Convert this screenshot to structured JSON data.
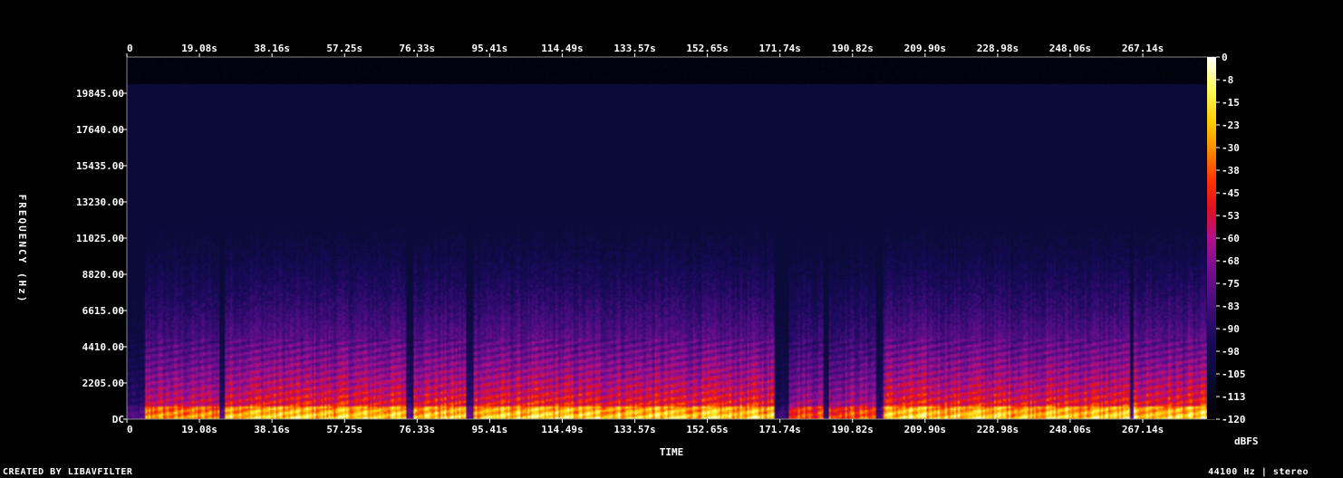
{
  "chart_data": {
    "type": "heatmap",
    "xlabel": "TIME",
    "ylabel": "FREQUENCY (Hz)",
    "x_ticks": [
      "0",
      "19.08s",
      "38.16s",
      "57.25s",
      "76.33s",
      "95.41s",
      "114.49s",
      "133.57s",
      "152.65s",
      "171.74s",
      "190.82s",
      "209.90s",
      "228.98s",
      "248.06s",
      "267.14s"
    ],
    "x_tick_values": [
      0,
      19.08,
      38.16,
      57.25,
      76.33,
      95.41,
      114.49,
      133.57,
      152.65,
      171.74,
      190.82,
      209.9,
      228.98,
      248.06,
      267.14
    ],
    "xlim": [
      0,
      286.2
    ],
    "y_ticks": [
      "DC",
      "2205.00",
      "4410.00",
      "6615.00",
      "8820.00",
      "11025.00",
      "13230.00",
      "15435.00",
      "17640.00",
      "19845.00"
    ],
    "y_tick_values": [
      0,
      2205,
      4410,
      6615,
      8820,
      11025,
      13230,
      15435,
      17640,
      19845
    ],
    "ylim": [
      0,
      22050
    ],
    "colorbar": {
      "label": "dBFS",
      "ticks": [
        "0",
        "-8",
        "-15",
        "-23",
        "-30",
        "-38",
        "-45",
        "-53",
        "-60",
        "-68",
        "-75",
        "-83",
        "-90",
        "-98",
        "-105",
        "-113",
        "-120"
      ],
      "range": [
        -120,
        0
      ],
      "colors": [
        "#000000",
        "#0b0b3a",
        "#1a0a5c",
        "#4a0d80",
        "#7a0f90",
        "#b0108a",
        "#e01020",
        "#ff3300",
        "#ff8800",
        "#ffcc00",
        "#ffff66",
        "#ffffff"
      ]
    },
    "quiet_segments": [
      [
        0,
        4.5
      ],
      [
        24,
        25.5
      ],
      [
        73,
        75
      ],
      [
        89,
        91
      ],
      [
        170,
        174
      ],
      [
        183,
        184.5
      ],
      [
        197,
        198.5
      ],
      [
        263.5,
        264.5
      ]
    ],
    "band_limit_hz": 20500
  },
  "footer": {
    "left": "CREATED BY LIBAVFILTER",
    "right": "44100 Hz | stereo"
  }
}
